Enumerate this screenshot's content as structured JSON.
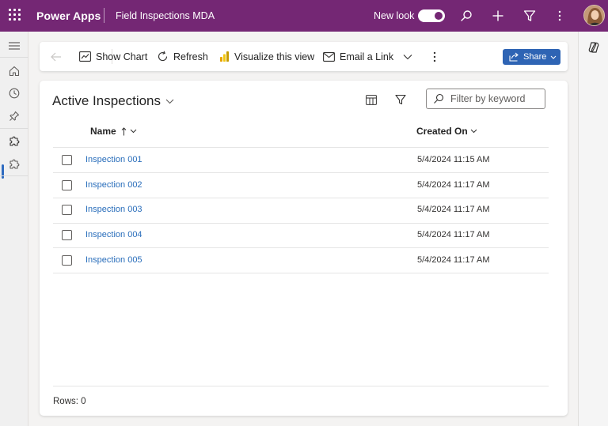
{
  "header": {
    "brand": "Power Apps",
    "app_name": "Field Inspections MDA",
    "new_look_label": "New look",
    "new_look_on": true
  },
  "commands": {
    "show_chart": "Show Chart",
    "refresh": "Refresh",
    "visualize": "Visualize this view",
    "email_link": "Email a Link",
    "share": "Share"
  },
  "view": {
    "title": "Active Inspections",
    "filter_placeholder": "Filter by keyword",
    "columns": [
      "Name",
      "Created On"
    ],
    "rows": [
      {
        "name": "Inspection 001",
        "created": "5/4/2024 11:15 AM"
      },
      {
        "name": "Inspection 002",
        "created": "5/4/2024 11:17 AM"
      },
      {
        "name": "Inspection 003",
        "created": "5/4/2024 11:17 AM"
      },
      {
        "name": "Inspection 004",
        "created": "5/4/2024 11:17 AM"
      },
      {
        "name": "Inspection 005",
        "created": "5/4/2024 11:17 AM"
      }
    ],
    "row_count": "Rows: 0"
  },
  "colors": {
    "header_bg": "#742774",
    "link": "#2a6ebb",
    "primary_button": "#2e64b4"
  }
}
